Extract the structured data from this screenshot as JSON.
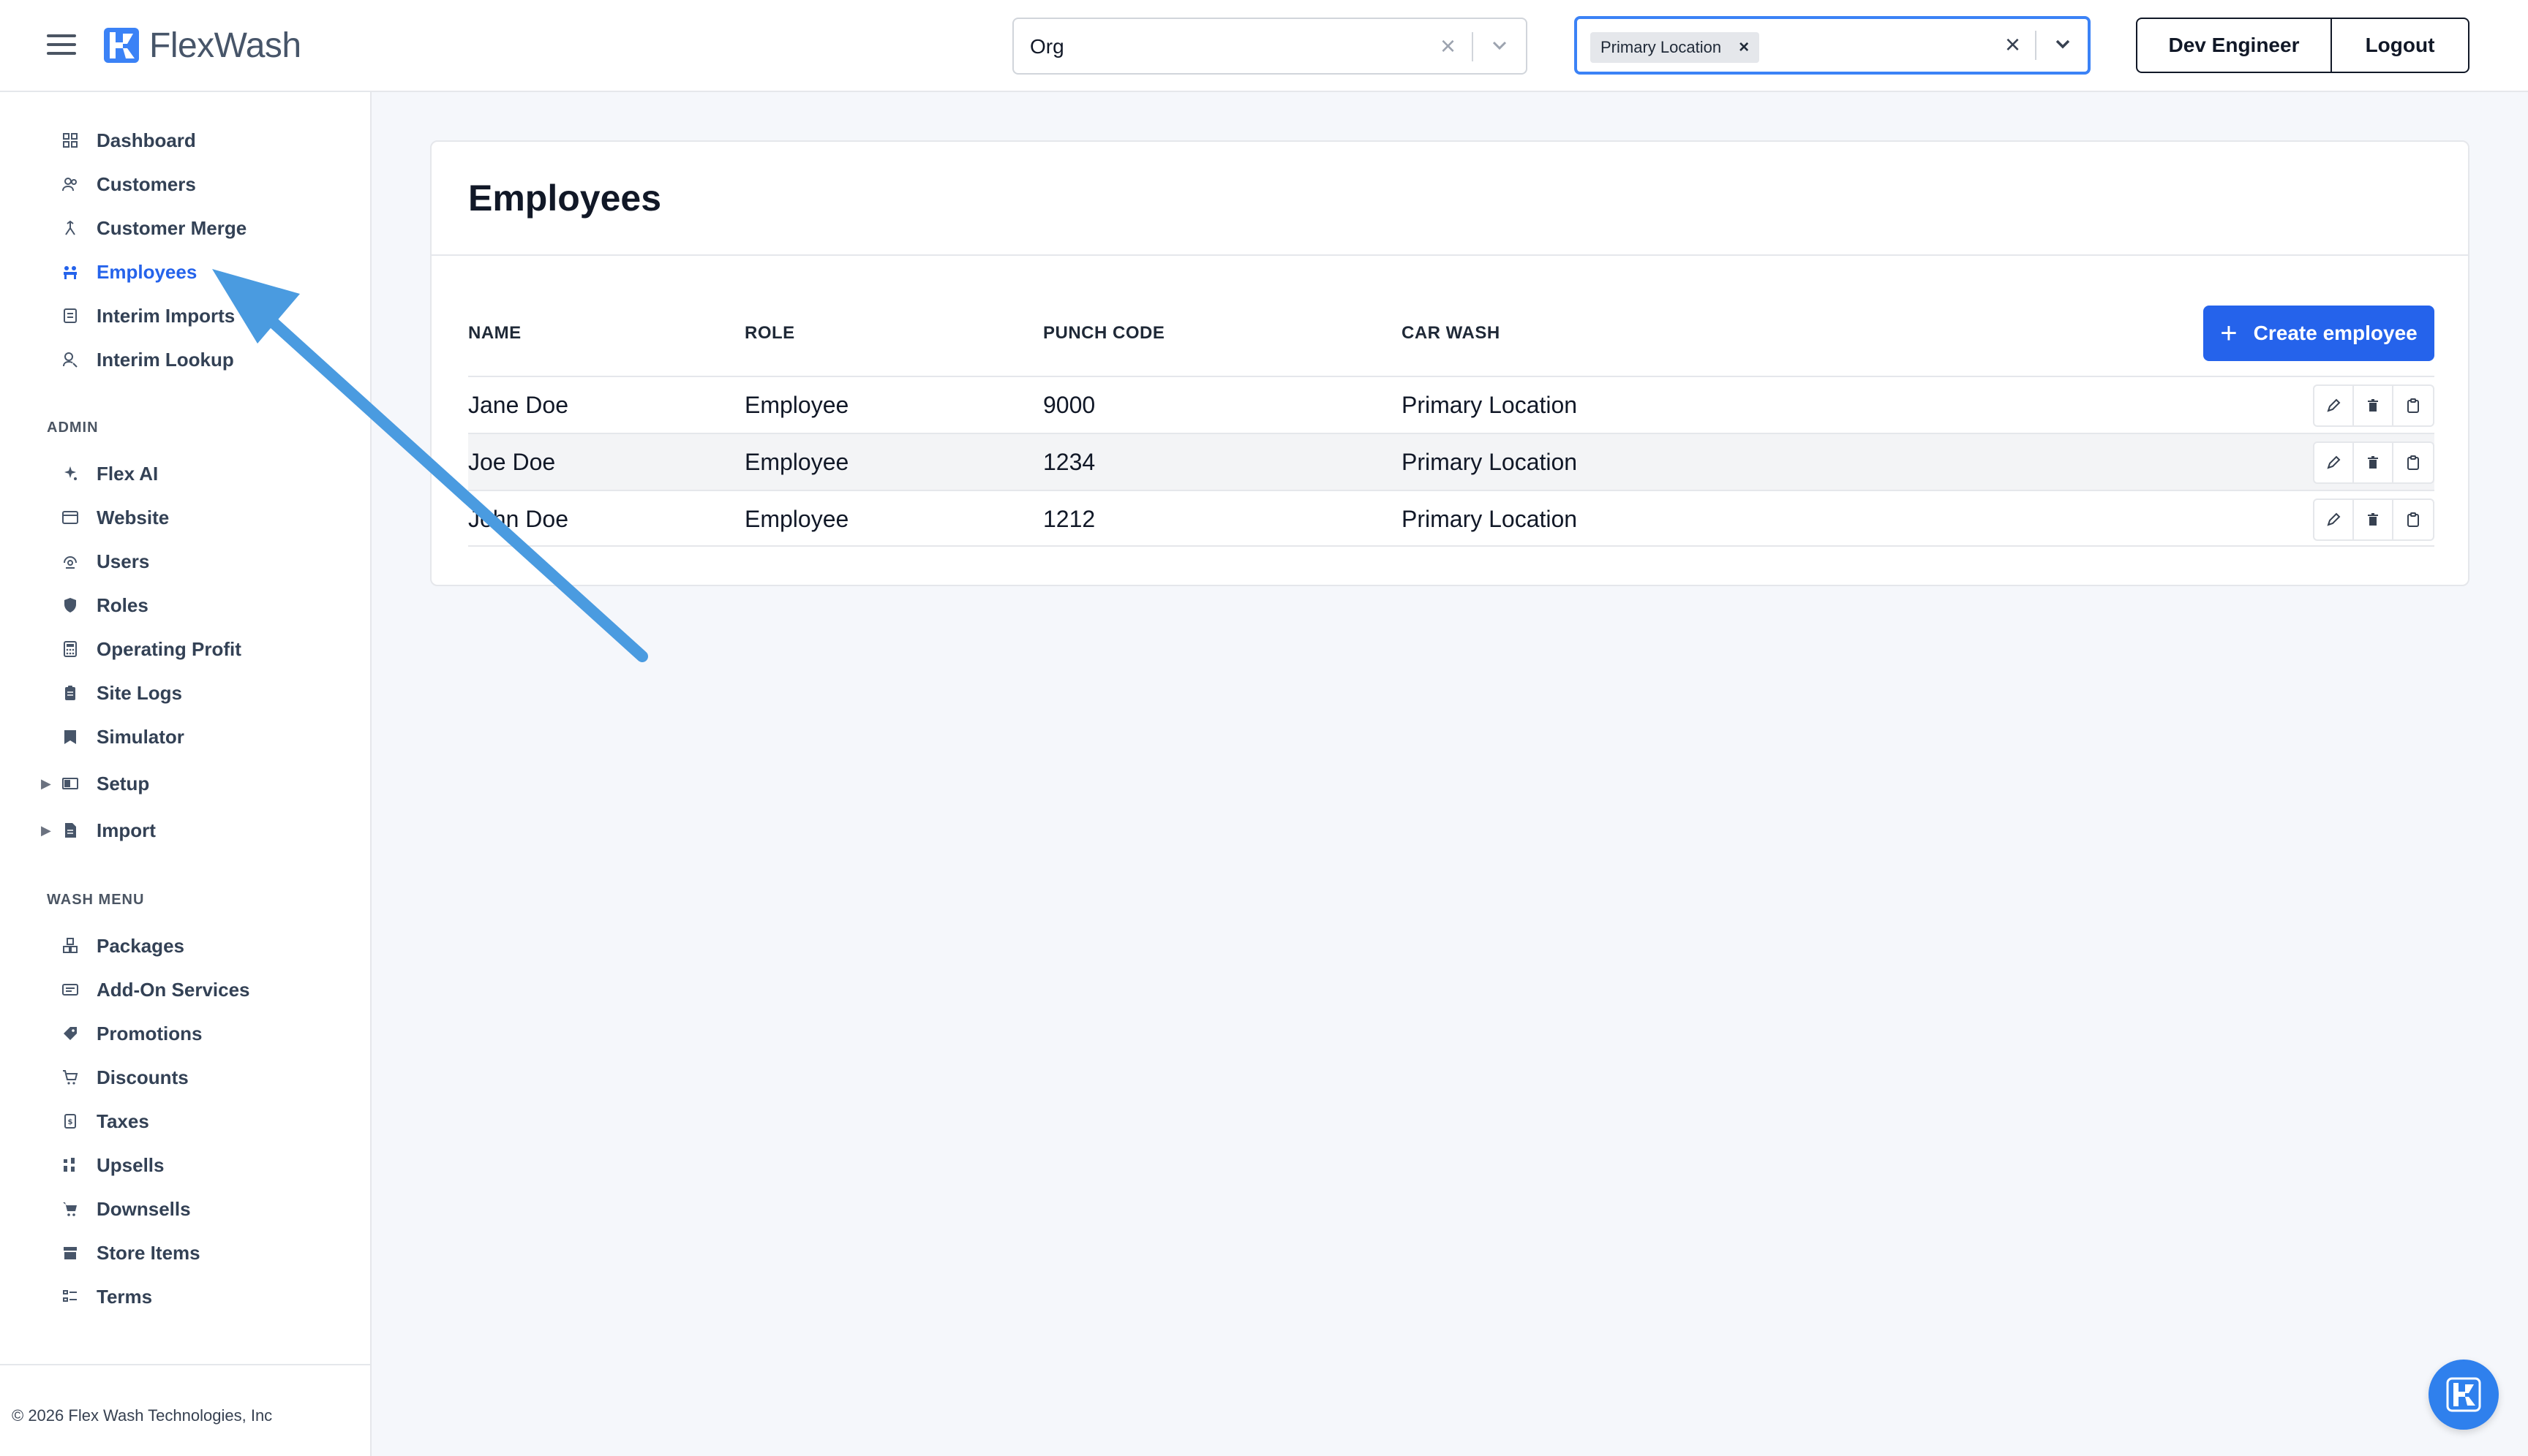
{
  "brand": {
    "name": "FlexWash",
    "accent": "#2563eb"
  },
  "header": {
    "org_select": {
      "value": "Org"
    },
    "location_select": {
      "chip": "Primary Location"
    },
    "user_button": "Dev Engineer",
    "logout_button": "Logout"
  },
  "sidebar": {
    "main": [
      {
        "label": "Dashboard",
        "icon": "dashboard-icon"
      },
      {
        "label": "Customers",
        "icon": "customers-icon"
      },
      {
        "label": "Customer Merge",
        "icon": "merge-icon"
      },
      {
        "label": "Employees",
        "icon": "employees-icon",
        "active": true
      },
      {
        "label": "Interim Imports",
        "icon": "imports-icon"
      },
      {
        "label": "Interim Lookup",
        "icon": "lookup-icon"
      }
    ],
    "admin_label": "ADMIN",
    "admin": [
      {
        "label": "Flex AI",
        "icon": "sparkle-icon"
      },
      {
        "label": "Website",
        "icon": "website-icon"
      },
      {
        "label": "Users",
        "icon": "users-icon"
      },
      {
        "label": "Roles",
        "icon": "shield-icon"
      },
      {
        "label": "Operating Profit",
        "icon": "calculator-icon"
      },
      {
        "label": "Site Logs",
        "icon": "clipboard-icon"
      },
      {
        "label": "Simulator",
        "icon": "simulator-icon"
      },
      {
        "label": "Setup",
        "icon": "setup-icon",
        "expandable": true
      },
      {
        "label": "Import",
        "icon": "file-icon",
        "expandable": true
      }
    ],
    "wash_menu_label": "WASH MENU",
    "wash_menu": [
      {
        "label": "Packages",
        "icon": "packages-icon"
      },
      {
        "label": "Add-On Services",
        "icon": "addon-icon"
      },
      {
        "label": "Promotions",
        "icon": "tag-icon"
      },
      {
        "label": "Discounts",
        "icon": "discount-icon"
      },
      {
        "label": "Taxes",
        "icon": "tax-icon"
      },
      {
        "label": "Upsells",
        "icon": "upsell-icon"
      },
      {
        "label": "Downsells",
        "icon": "cart-icon"
      },
      {
        "label": "Store Items",
        "icon": "store-icon"
      },
      {
        "label": "Terms",
        "icon": "terms-icon"
      }
    ],
    "footer": "© 2026 Flex Wash Technologies, Inc"
  },
  "main": {
    "title": "Employees",
    "create_button": "Create employee",
    "columns": [
      "NAME",
      "ROLE",
      "PUNCH CODE",
      "CAR WASH"
    ],
    "rows": [
      {
        "name": "Jane Doe",
        "role": "Employee",
        "punch_code": "9000",
        "car_wash": "Primary Location"
      },
      {
        "name": "Joe Doe",
        "role": "Employee",
        "punch_code": "1234",
        "car_wash": "Primary Location"
      },
      {
        "name": "John Doe",
        "role": "Employee",
        "punch_code": "1212",
        "car_wash": "Primary Location"
      }
    ]
  }
}
